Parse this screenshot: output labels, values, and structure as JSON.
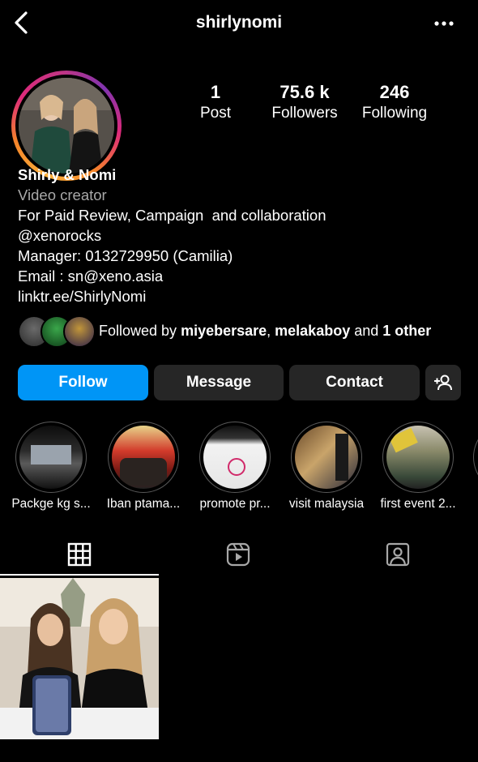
{
  "header": {
    "username": "shirlynomi"
  },
  "profile": {
    "stats": [
      {
        "value": "1",
        "label": "Post"
      },
      {
        "value": "75.6 k",
        "label": "Followers"
      },
      {
        "value": "246",
        "label": "Following"
      }
    ],
    "display_name": "Shirly & Nomi",
    "category": "Video creator",
    "bio_lines": [
      "For Paid Review, Campaign  and collaboration",
      "@xenorocks",
      "Manager: 0132729950 (Camilia)",
      "Email : sn@xeno.asia",
      "linktr.ee/ShirlyNomi"
    ],
    "followed_by": {
      "prefix": "Followed by ",
      "name1": "miyebersare",
      "sep": ", ",
      "name2": "melakaboy",
      "and": " and ",
      "other": "1 other"
    }
  },
  "buttons": {
    "follow": "Follow",
    "message": "Message",
    "contact": "Contact"
  },
  "highlights": [
    {
      "label": "Packge kg s..."
    },
    {
      "label": "Iban ptama..."
    },
    {
      "label": "promote pr..."
    },
    {
      "label": "visit malaysia"
    },
    {
      "label": "first event 2..."
    }
  ],
  "tabs": [
    "grid-icon",
    "reels-icon",
    "tagged-icon"
  ],
  "colors": {
    "accent": "#0095f6",
    "button_bg": "#262626",
    "secondary_text": "#a8a8a8"
  }
}
